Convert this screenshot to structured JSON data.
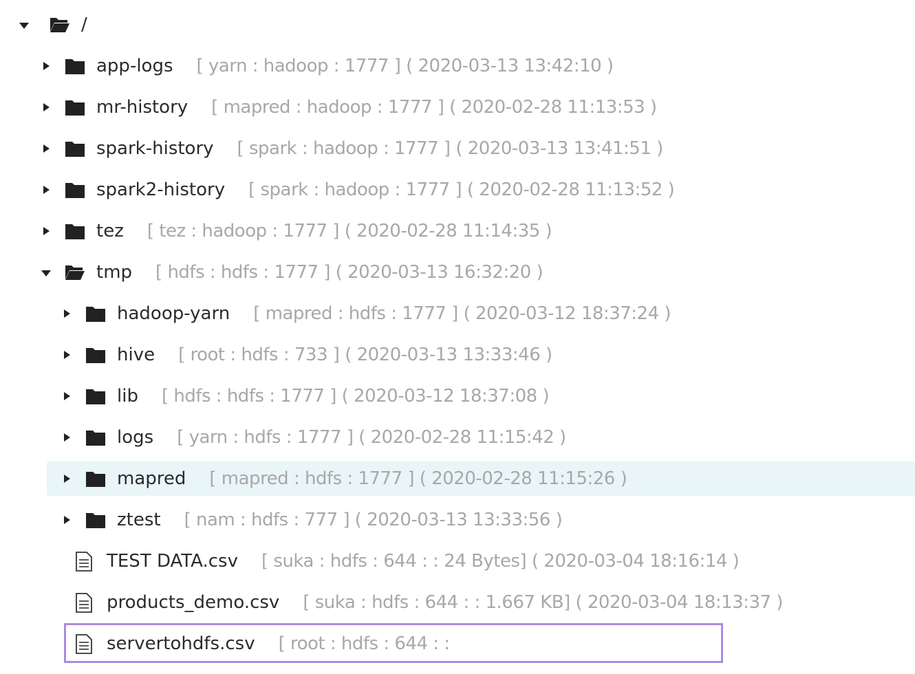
{
  "root": {
    "name": "/"
  },
  "nodes": [
    {
      "type": "folder",
      "depth": 1,
      "expanded": false,
      "name": "app-logs",
      "meta": "[ yarn : hadoop : 1777 ] ( 2020-03-13 13:42:10 )"
    },
    {
      "type": "folder",
      "depth": 1,
      "expanded": false,
      "name": "mr-history",
      "meta": "[ mapred : hadoop : 1777 ] ( 2020-02-28 11:13:53 )"
    },
    {
      "type": "folder",
      "depth": 1,
      "expanded": false,
      "name": "spark-history",
      "meta": "[ spark : hadoop : 1777 ] ( 2020-03-13 13:41:51 )"
    },
    {
      "type": "folder",
      "depth": 1,
      "expanded": false,
      "name": "spark2-history",
      "meta": "[ spark : hadoop : 1777 ] ( 2020-02-28 11:13:52 )"
    },
    {
      "type": "folder",
      "depth": 1,
      "expanded": false,
      "name": "tez",
      "meta": "[ tez : hadoop : 1777 ] ( 2020-02-28 11:14:35 )"
    },
    {
      "type": "folder",
      "depth": 1,
      "expanded": true,
      "name": "tmp",
      "meta": "[ hdfs : hdfs : 1777 ] ( 2020-03-13 16:32:20 )"
    },
    {
      "type": "folder",
      "depth": 2,
      "expanded": false,
      "name": "hadoop-yarn",
      "meta": "[ mapred : hdfs : 1777 ] ( 2020-03-12 18:37:24 )"
    },
    {
      "type": "folder",
      "depth": 2,
      "expanded": false,
      "name": "hive",
      "meta": "[ root : hdfs : 733 ] ( 2020-03-13 13:33:46 )"
    },
    {
      "type": "folder",
      "depth": 2,
      "expanded": false,
      "name": "lib",
      "meta": "[ hdfs : hdfs : 1777 ] ( 2020-03-12 18:37:08 )"
    },
    {
      "type": "folder",
      "depth": 2,
      "expanded": false,
      "name": "logs",
      "meta": "[ yarn : hdfs : 1777 ] ( 2020-02-28 11:15:42 )"
    },
    {
      "type": "folder",
      "depth": 2,
      "expanded": false,
      "selected": true,
      "name": "mapred",
      "meta": "[ mapred : hdfs : 1777 ] ( 2020-02-28 11:15:26 )"
    },
    {
      "type": "folder",
      "depth": 2,
      "expanded": false,
      "name": "ztest",
      "meta": "[ nam : hdfs : 777 ] ( 2020-03-13 13:33:56 )"
    },
    {
      "type": "file",
      "depth": 2,
      "name": "TEST DATA.csv",
      "meta": "[ suka : hdfs : 644 : : 24 Bytes] ( 2020-03-04 18:16:14 )"
    },
    {
      "type": "file",
      "depth": 2,
      "name": "products_demo.csv",
      "meta": "[ suka : hdfs : 644 : : 1.667 KB] ( 2020-03-04 18:13:37 )"
    },
    {
      "type": "file",
      "depth": 2,
      "highlighted": true,
      "name": "servertohdfs.csv",
      "meta": "[ root : hdfs : 644 : :"
    }
  ],
  "colors": {
    "selected_bg": "#e9f5f7",
    "highlight_border": "#a98be0",
    "meta_text": "#a8a8a8",
    "name_text": "#2b2b2b"
  }
}
